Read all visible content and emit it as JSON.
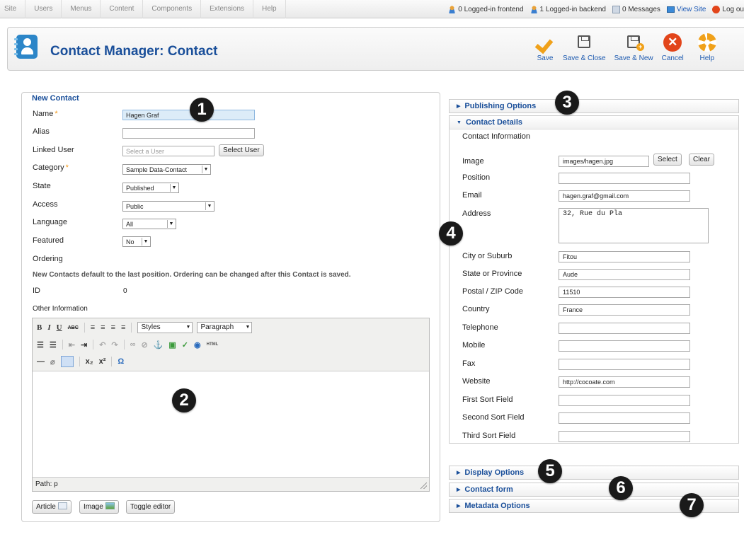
{
  "topbar": {
    "menu": [
      "Site",
      "Users",
      "Menus",
      "Content",
      "Components",
      "Extensions",
      "Help"
    ],
    "status": {
      "frontend": "0 Logged-in frontend",
      "backend": "1 Logged-in backend",
      "messages": "0 Messages",
      "view_site": "View Site",
      "logout": "Log ou"
    }
  },
  "header": {
    "title": "Contact Manager: Contact",
    "toolbar": {
      "save": "Save",
      "save_close": "Save & Close",
      "save_new": "Save & New",
      "cancel": "Cancel",
      "help": "Help"
    }
  },
  "form": {
    "legend": "New Contact",
    "name_label": "Name",
    "name_value": "Hagen Graf",
    "alias_label": "Alias",
    "alias_value": "",
    "linked_user_label": "Linked User",
    "linked_user_placeholder": "Select a User",
    "select_user_button": "Select User",
    "category_label": "Category",
    "category_value": "Sample Data-Contact",
    "state_label": "State",
    "state_value": "Published",
    "access_label": "Access",
    "access_value": "Public",
    "language_label": "Language",
    "language_value": "All",
    "featured_label": "Featured",
    "featured_value": "No",
    "ordering_label": "Ordering",
    "ordering_note": "New Contacts default to the last position. Ordering can be changed after this Contact is saved.",
    "id_label": "ID",
    "id_value": "0",
    "other_info_label": "Other Information",
    "required_mark": "*"
  },
  "editor": {
    "styles_combo": "Styles",
    "format_combo": "Paragraph",
    "path": "Path: p",
    "buttons": {
      "article": "Article",
      "image": "Image",
      "toggle": "Toggle editor"
    }
  },
  "right": {
    "publishing_options": "Publishing Options",
    "contact_details": "Contact Details",
    "contact_information": "Contact Information",
    "image_label": "Image",
    "image_value": "images/hagen.jpg",
    "select_button": "Select",
    "clear_button": "Clear",
    "position_label": "Position",
    "position_value": "",
    "email_label": "Email",
    "email_value": "hagen.graf@gmail.com",
    "address_label": "Address",
    "address_value": "32, Rue du Pla",
    "city_label": "City or Suburb",
    "city_value": "Fitou",
    "state_label": "State or Province",
    "state_value": "Aude",
    "postal_label": "Postal / ZIP Code",
    "postal_value": "11510",
    "country_label": "Country",
    "country_value": "France",
    "telephone_label": "Telephone",
    "mobile_label": "Mobile",
    "fax_label": "Fax",
    "website_label": "Website",
    "website_value": "http://cocoate.com",
    "first_sort_label": "First Sort Field",
    "second_sort_label": "Second Sort Field",
    "third_sort_label": "Third Sort Field",
    "display_options": "Display Options",
    "contact_form": "Contact form",
    "metadata_options": "Metadata Options"
  },
  "callouts": [
    "1",
    "2",
    "3",
    "4",
    "5",
    "6",
    "7"
  ],
  "colors": {
    "accent": "#1a4f9a",
    "required": "#f39a1a",
    "cancel": "#e2451a",
    "save": "#f0a11a"
  }
}
